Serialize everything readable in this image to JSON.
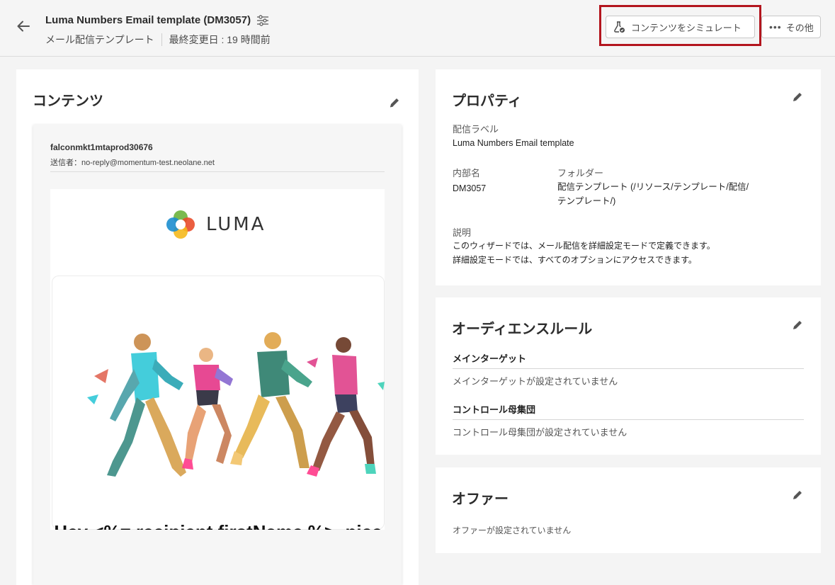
{
  "header": {
    "title": "Luma Numbers Email template (DM3057)",
    "type_label": "メール配信テンプレート",
    "modified": "最終変更日 : 19 時間前",
    "simulate_label": "コンテンツをシミュレート",
    "more_label": "その他"
  },
  "content": {
    "title": "コンテンツ",
    "sender_name": "falconmkt1mtaprod30676",
    "sender_from": "送信者：no-reply@momentum-test.neolane.net",
    "logo_text": "LUMA",
    "greeting": "Hey <%= recipient.firstName %>, nice to have you onboard"
  },
  "properties": {
    "title": "プロパティ",
    "label_caption": "配信ラベル",
    "label_value": "Luma Numbers Email template",
    "internal_name_caption": "内部名",
    "internal_name_value": "DM3057",
    "folder_caption": "フォルダー",
    "folder_value_line1": "配信テンプレート (/リソース/テンプレート/配信/",
    "folder_value_line2": "テンプレート/)",
    "description_caption": "説明",
    "description_line1": "このウィザードでは、メール配信を詳細設定モードで定義できます。",
    "description_line2": "詳細設定モードでは、すべてのオプションにアクセスできます。"
  },
  "audience": {
    "title": "オーディエンスルール",
    "main_target_label": "メインターゲット",
    "main_target_empty": "メインターゲットが設定されていません",
    "control_label": "コントロール母集団",
    "control_empty": "コントロール母集団が設定されていません"
  },
  "offers": {
    "title": "オファー",
    "empty": "オファーが設定されていません"
  },
  "colors": {
    "highlight": "#b3151e",
    "background": "#f4f4f4"
  }
}
